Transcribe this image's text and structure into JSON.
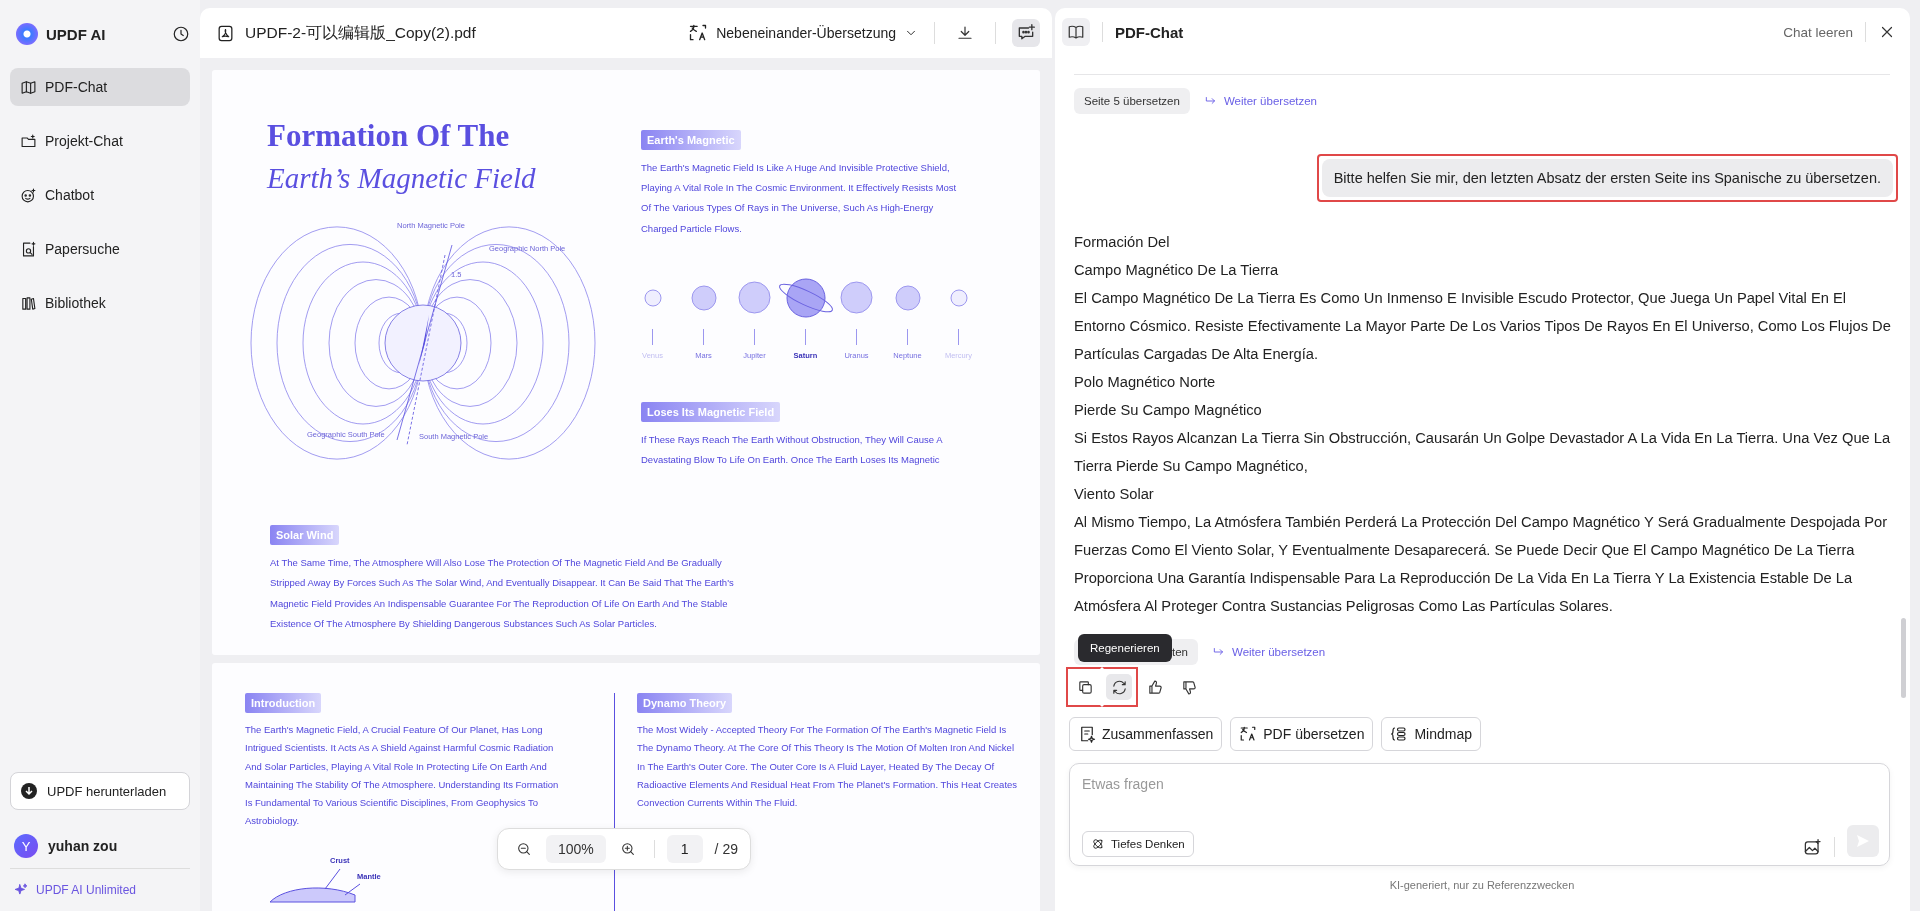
{
  "sidebar": {
    "brand": "UPDF AI",
    "items": [
      {
        "label": "PDF-Chat",
        "selected": true
      },
      {
        "label": "Projekt-Chat",
        "selected": false
      },
      {
        "label": "Chatbot",
        "selected": false
      },
      {
        "label": "Papersuche",
        "selected": false
      },
      {
        "label": "Bibliothek",
        "selected": false
      }
    ],
    "download_button": "UPDF herunterladen",
    "user": {
      "initial": "Y",
      "name": "yuhan zou"
    },
    "plan": "UPDF AI Unlimited"
  },
  "document": {
    "file_name": "UPDF-2-可以编辑版_Copy(2).pdf",
    "view_mode": "Nebeneinander-Übersetzung",
    "page_1": {
      "title_line_1": "Formation Of The",
      "title_line_2": "Earth’s Magnetic Field",
      "diagram_labels": {
        "north_magnetic_pole": "North Magnetic Pole",
        "geographic_north_pole": "Geographic North Pole",
        "angle": "1.5",
        "geographic_south_pole": "Geographic South Pole",
        "south_magnetic_pole": "South Magnetic Pole"
      },
      "sections": [
        {
          "heading": "Earth's Magnetic",
          "text": "The Earth's Magnetic Field Is Like A Huge And Invisible Protective Shield, Playing A Vital Role In The Cosmic Environment. It Effectively Resists Most Of The Various Types Of Rays in The Universe, Such As High-Energy Charged Particle Flows."
        },
        {
          "heading": "Loses Its Magnetic Field",
          "text": "If These Rays Reach The Earth Without Obstruction, They Will Cause A Devastating Blow To Life On Earth. Once The Earth Loses Its Magnetic"
        },
        {
          "heading": "Solar Wind",
          "text": "At The Same Time, The Atmosphere Will Also Lose The Protection Of The Magnetic Field And Be Gradually Stripped Away By Forces Such As The Solar Wind, And Eventually Disappear. It Can Be Said That The Earth's Magnetic Field Provides An Indispensable Guarantee For The Reproduction Of Life On Earth And The Stable Existence Of The Atmosphere By Shielding Dangerous Substances Such As Solar Particles."
        }
      ],
      "planets": [
        {
          "name": "Venus",
          "kind": "plain"
        },
        {
          "name": "Mars",
          "kind": "plain"
        },
        {
          "name": "Jupiter",
          "kind": "plain"
        },
        {
          "name": "Saturn",
          "kind": "ringed"
        },
        {
          "name": "Uranus",
          "kind": "plain"
        },
        {
          "name": "Neptune",
          "kind": "plain"
        },
        {
          "name": "Mercury",
          "kind": "plain"
        }
      ]
    },
    "page_2": {
      "sections": [
        {
          "heading": "Introduction",
          "text": "The Earth's Magnetic Field, A Crucial Feature Of Our Planet, Has Long Intrigued Scientists. It Acts As A Shield Against Harmful Cosmic Radiation And Solar Particles, Playing A Vital Role In Protecting Life On Earth And Maintaining The Stability Of The Atmosphere. Understanding Its Formation Is Fundamental To Various Scientific Disciplines, From Geophysics To Astrobiology."
        },
        {
          "heading": "Dynamo Theory",
          "text": "The Most Widely - Accepted Theory For The Formation Of The Earth's Magnetic Field Is The Dynamo Theory. At The Core Of This Theory Is The Motion Of Molten Iron And Nickel In The Earth's Outer Core. The Outer Core Is A Fluid Layer, Heated By The Decay Of Radioactive Elements And Residual Heat From The Planet's Formation. This Heat Creates Convection Currents Within The Fluid."
        }
      ],
      "diagram_labels": {
        "crust": "Crust",
        "mantle": "Mantle"
      }
    },
    "zoom_toolbar": {
      "zoom": "100%",
      "page": "1",
      "total": "/ 29"
    }
  },
  "chat": {
    "title": "PDF-Chat",
    "clear": "Chat leeren",
    "actions_1": {
      "chip": "Seite 5 übersetzen",
      "link": "Weiter übersetzen"
    },
    "user_message": {
      "text": "Bitte helfen Sie mir, den letzten Absatz der ersten Seite ins Spanische zu übersetzen.",
      "highlighted": true
    },
    "response": [
      "Formación Del",
      "Campo Magnético De La Tierra",
      "El Campo Magnético De La Tierra Es Como Un Inmenso E Invisible Escudo Protector, Que Juega Un Papel Vital En El Entorno Cósmico. Resiste Efectivamente La Mayor Parte De Los Varios Tipos De Rayos En El Universo, Como Los Flujos De Partículas Cargadas De Alta Energía.",
      "Polo Magnético Norte",
      "Pierde Su Campo Magnético",
      "Si Estos Rayos Alcanzan La Tierra Sin Obstrucción, Causarán Un Golpe Devastador A La Vida En La Tierra. Una Vez Que La Tierra Pierde Su Campo Magnético,",
      "Viento Solar",
      "Al Mismo Tiempo, La Atmósfera También Perderá La Protección Del Campo Magnético Y Será Gradualmente Despojada Por Fuerzas Como El Viento Solar, Y Eventualmente Desaparecerá. Se Puede Decir Que El Campo Magnético De La Tierra Proporciona Una Garantía Indispensable Para La Reproducción De La Vida En La Tierra Y La Existencia Estable De La Atmósfera Al Proteger Contra Sustancias Peligrosas Como Las Partículas Solares."
    ],
    "actions_2": {
      "chip": "ten",
      "link": "Weiter übersetzen"
    },
    "message_actions": [
      {
        "kind": "copy",
        "highlighted": true,
        "hovered": false
      },
      {
        "kind": "regenerate",
        "highlighted": true,
        "hovered": true,
        "tooltip": "Regenerieren"
      },
      {
        "kind": "like",
        "highlighted": false,
        "hovered": false
      },
      {
        "kind": "dislike",
        "highlighted": false,
        "hovered": false
      }
    ],
    "quick_actions": [
      "Zusammenfassen",
      "PDF übersetzen",
      "Mindmap"
    ],
    "input": {
      "placeholder": "Etwas fragen"
    },
    "deep_thinking": "Tiefes Denken",
    "footer": "KI-generiert, nur zu Referenzzwecken"
  }
}
